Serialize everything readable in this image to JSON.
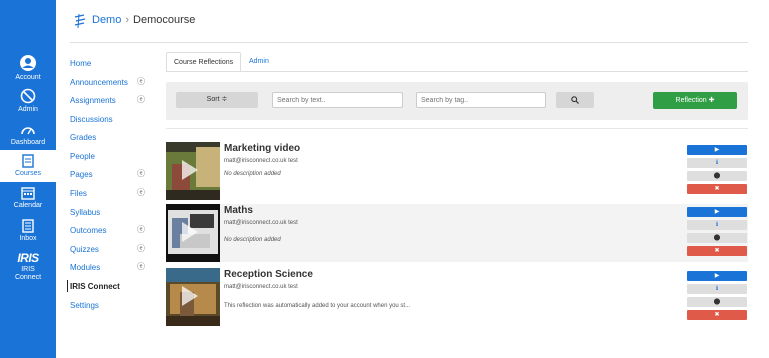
{
  "global_nav": {
    "items": [
      {
        "label": "Account",
        "icon": "account-icon"
      },
      {
        "label": "Admin",
        "icon": "admin-icon"
      },
      {
        "label": "Dashboard",
        "icon": "dashboard-icon"
      },
      {
        "label": "Courses",
        "icon": "courses-icon"
      },
      {
        "label": "Calendar",
        "icon": "calendar-icon"
      },
      {
        "label": "Inbox",
        "icon": "inbox-icon"
      },
      {
        "label": "IRIS Connect",
        "logo": "IRIS",
        "icon": "iris-logo-icon"
      }
    ],
    "colors": {
      "bg": "#1a73d6",
      "active_bg": "#ffffff"
    }
  },
  "breadcrumb": {
    "items": [
      "Demo",
      "Democourse"
    ],
    "separator": "›"
  },
  "course_nav": {
    "items": [
      {
        "label": "Home",
        "eye": ""
      },
      {
        "label": "Announcements",
        "eye": "ⓔ"
      },
      {
        "label": "Assignments",
        "eye": "ⓔ"
      },
      {
        "label": "Discussions",
        "eye": ""
      },
      {
        "label": "Grades",
        "eye": ""
      },
      {
        "label": "People",
        "eye": ""
      },
      {
        "label": "Pages",
        "eye": "ⓔ"
      },
      {
        "label": "Files",
        "eye": "ⓔ"
      },
      {
        "label": "Syllabus",
        "eye": ""
      },
      {
        "label": "Outcomes",
        "eye": "ⓔ"
      },
      {
        "label": "Quizzes",
        "eye": "ⓔ"
      },
      {
        "label": "Modules",
        "eye": "ⓔ"
      },
      {
        "label": "IRIS Connect",
        "eye": "",
        "active": true
      },
      {
        "label": "Settings",
        "eye": ""
      }
    ]
  },
  "tabs": [
    {
      "label": "Course Reflections",
      "active": true
    },
    {
      "label": "Admin",
      "active": false
    }
  ],
  "toolbar": {
    "sort_label": "Sort ≑",
    "search_text_placeholder": "Search by text..",
    "search_tag_placeholder": "Search by tag..",
    "search_button_icon": "search-icon",
    "reflection_label": "Reflection ✚",
    "colors": {
      "reflection_bg": "#2f9e44"
    }
  },
  "reflections": [
    {
      "title": "Marketing video",
      "author": "matt@irisconnect.co.uk test",
      "description": "No description added",
      "thumb_colors": [
        "#6a7a3a",
        "#c7b27a",
        "#8b4a3a"
      ]
    },
    {
      "title": "Maths",
      "author": "matt@irisconnect.co.uk test",
      "description": "No description added",
      "thumb_colors": [
        "#3a3a3a",
        "#e0e0e0",
        "#6b7fa0"
      ]
    },
    {
      "title": "Reception Science",
      "author": "matt@irisconnect.co.uk test",
      "description": "This reflection was automatically added to your account when you st...",
      "thumb_colors": [
        "#5a4a2a",
        "#b58a4a",
        "#3a6a8a"
      ]
    }
  ],
  "actions": {
    "play": "▶",
    "info": "ℹ",
    "tag": "⬤",
    "delete": "✖",
    "colors": {
      "play": "#1a73d6",
      "delete": "#e05a4a",
      "neutral": "#dedede"
    }
  }
}
